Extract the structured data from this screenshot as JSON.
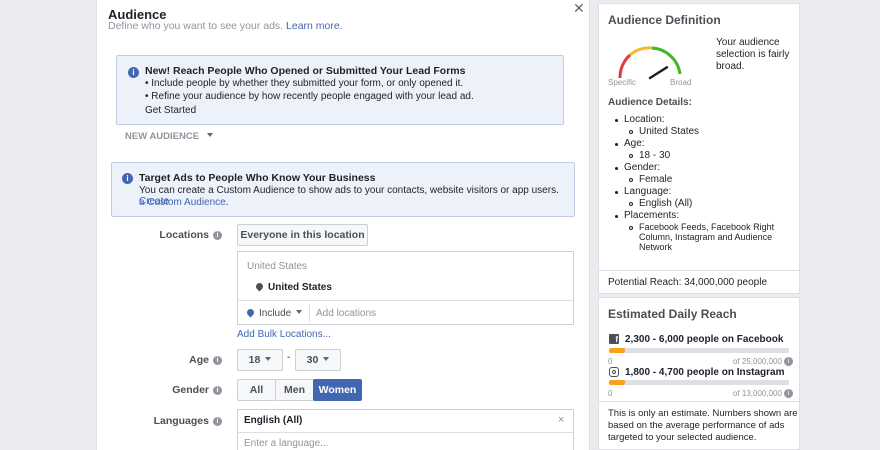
{
  "main": {
    "title": "Audience",
    "subtitle": "Define who you want to see your ads.",
    "learn_more": "Learn more.",
    "close_symbol": "✕",
    "lead_box": {
      "title": "New! Reach People Who Opened or Submitted Your Lead Forms",
      "line1": "• Include people by whether they submitted your form, or only opened it.",
      "line2": "• Refine your audience by how recently people engaged with your lead ad.",
      "cta": "Get Started"
    },
    "new_audience": "NEW AUDIENCE",
    "custom_box": {
      "title": "Target Ads to People Who Know Your Business",
      "line1_prefix": "You can create a Custom Audience to show ads to your contacts, website visitors or app users.",
      "line1_link": "Create",
      "line2_link": "a Custom Audience",
      "line2_suffix": "."
    },
    "locations": {
      "label": "Locations",
      "dropdown": "Everyone in this location",
      "country_header": "United States",
      "selected": "United States",
      "include": "Include",
      "add_placeholder": "Add locations",
      "bulk": "Add Bulk Locations..."
    },
    "age": {
      "label": "Age",
      "min": "18",
      "max": "30",
      "dash": "-"
    },
    "gender": {
      "label": "Gender",
      "options": [
        "All",
        "Men",
        "Women"
      ],
      "selected": "Women"
    },
    "languages": {
      "label": "Languages",
      "value": "English (All)",
      "clear": "×",
      "placeholder": "Enter a language..."
    }
  },
  "side": {
    "definition": {
      "title": "Audience Definition",
      "gauge_level": 0.82,
      "gauge_left": "Specific",
      "gauge_right": "Broad",
      "desc": [
        "Your audience",
        "selection is fairly",
        "broad."
      ],
      "details_title": "Audience Details:",
      "details": [
        {
          "key": "Location:",
          "values": [
            "United States"
          ]
        },
        {
          "key": "Age:",
          "values": [
            "18 - 30"
          ]
        },
        {
          "key": "Gender:",
          "values": [
            "Female"
          ]
        },
        {
          "key": "Language:",
          "values": [
            "English (All)"
          ]
        },
        {
          "key": "Placements:",
          "values": [
            "Facebook Feeds, Facebook Right",
            "Column, Instagram and Audience",
            "Network"
          ]
        }
      ],
      "potential_reach": "Potential Reach: 34,000,000 people"
    },
    "daily": {
      "title": "Estimated Daily Reach",
      "facebook": {
        "text": "2,300 - 6,000 people on Facebook",
        "zero": "0",
        "max": "of 25,000,000",
        "fill": 0.09
      },
      "instagram": {
        "text": "1,800 - 4,700 people on Instagram",
        "zero": "0",
        "max": "of 13,000,000",
        "fill": 0.09
      },
      "note": [
        "This is only an estimate. Numbers shown are",
        "based on the average performance of ads",
        "targeted to your selected audience."
      ]
    },
    "colors": {
      "accent": "#4267b2",
      "bar": "#f7a21b"
    }
  }
}
